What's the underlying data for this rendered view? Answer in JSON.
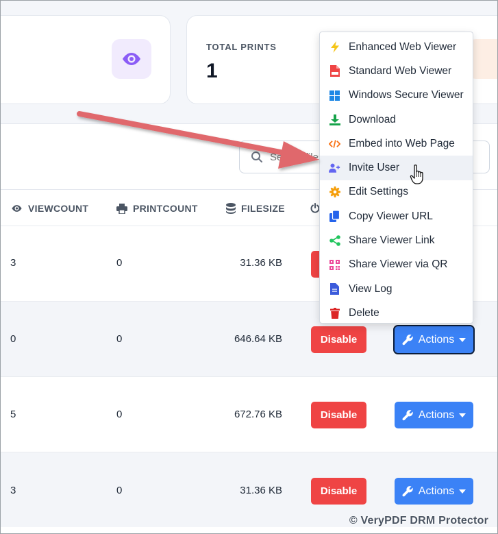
{
  "stats": {
    "prints_label": "TOTAL PRINTS",
    "prints_value": "1"
  },
  "search": {
    "placeholder": "Search files..."
  },
  "table": {
    "columns": [
      "VIEWCOUNT",
      "PRINTCOUNT",
      "FILESIZE"
    ],
    "rows": [
      {
        "viewcount": "3",
        "printcount": "0",
        "filesize": "31.36 KB"
      },
      {
        "viewcount": "0",
        "printcount": "0",
        "filesize": "646.64 KB"
      },
      {
        "viewcount": "5",
        "printcount": "0",
        "filesize": "672.76 KB"
      },
      {
        "viewcount": "3",
        "printcount": "0",
        "filesize": "31.36 KB"
      }
    ],
    "disable_label": "Disable",
    "actions_label": "Actions"
  },
  "menu": {
    "items": [
      {
        "label": "Enhanced Web Viewer",
        "icon": "lightning-icon"
      },
      {
        "label": "Standard Web Viewer",
        "icon": "pdf-file-icon"
      },
      {
        "label": "Windows Secure Viewer",
        "icon": "windows-icon"
      },
      {
        "label": "Download",
        "icon": "download-icon"
      },
      {
        "label": "Embed into Web Page",
        "icon": "code-icon"
      },
      {
        "label": "Invite User",
        "icon": "user-plus-icon"
      },
      {
        "label": "Edit Settings",
        "icon": "gear-icon"
      },
      {
        "label": "Copy Viewer URL",
        "icon": "copy-icon"
      },
      {
        "label": "Share Viewer Link",
        "icon": "share-icon"
      },
      {
        "label": "Share Viewer via QR",
        "icon": "qr-code-icon"
      },
      {
        "label": "View Log",
        "icon": "log-file-icon"
      },
      {
        "label": "Delete",
        "icon": "trash-icon"
      }
    ],
    "hovered_index": 5
  },
  "colors": {
    "disable": "#ef4444",
    "actions": "#3b82f6",
    "annotation_arrow": "#e0676c"
  },
  "watermark": "© VeryPDF DRM Protector"
}
